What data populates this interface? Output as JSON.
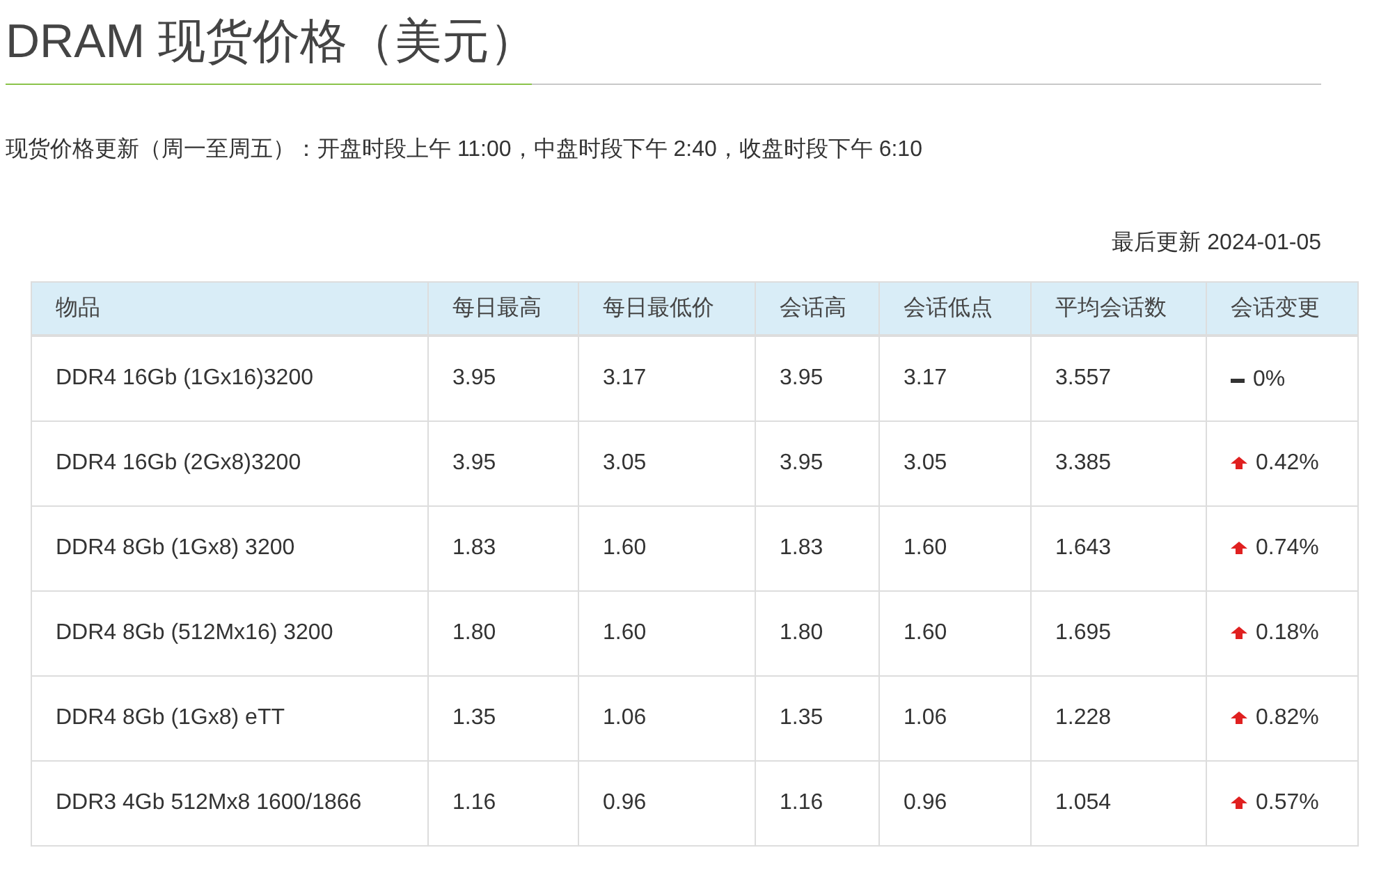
{
  "title": "DRAM 现货价格（美元）",
  "update_note": "现货价格更新（周一至周五）：开盘时段上午 11:00，中盘时段下午 2:40，收盘时段下午 6:10",
  "last_updated": "最后更新 2024-01-05",
  "table": {
    "columns": [
      "物品",
      "每日最高",
      "每日最低价",
      "会话高",
      "会话低点",
      "平均会话数",
      "会话变更"
    ],
    "rows": [
      {
        "cells": [
          "DDR4 16Gb (1Gx16)3200",
          "3.95",
          "3.17",
          "3.95",
          "3.17",
          "3.557"
        ],
        "change": {
          "kind": "flat",
          "text": "0%"
        }
      },
      {
        "cells": [
          "DDR4 16Gb (2Gx8)3200",
          "3.95",
          "3.05",
          "3.95",
          "3.05",
          "3.385"
        ],
        "change": {
          "kind": "up",
          "text": "0.42%"
        }
      },
      {
        "cells": [
          "DDR4 8Gb (1Gx8) 3200",
          "1.83",
          "1.60",
          "1.83",
          "1.60",
          "1.643"
        ],
        "change": {
          "kind": "up",
          "text": "0.74%"
        }
      },
      {
        "cells": [
          "DDR4 8Gb (512Mx16) 3200",
          "1.80",
          "1.60",
          "1.80",
          "1.60",
          "1.695"
        ],
        "change": {
          "kind": "up",
          "text": "0.18%"
        }
      },
      {
        "cells": [
          "DDR4 8Gb (1Gx8) eTT",
          "1.35",
          "1.06",
          "1.35",
          "1.06",
          "1.228"
        ],
        "change": {
          "kind": "up",
          "text": "0.82%"
        }
      },
      {
        "cells": [
          "DDR3 4Gb 512Mx8 1600/1866",
          "1.16",
          "0.96",
          "1.16",
          "0.96",
          "1.054"
        ],
        "change": {
          "kind": "up",
          "text": "0.57%"
        }
      }
    ]
  }
}
